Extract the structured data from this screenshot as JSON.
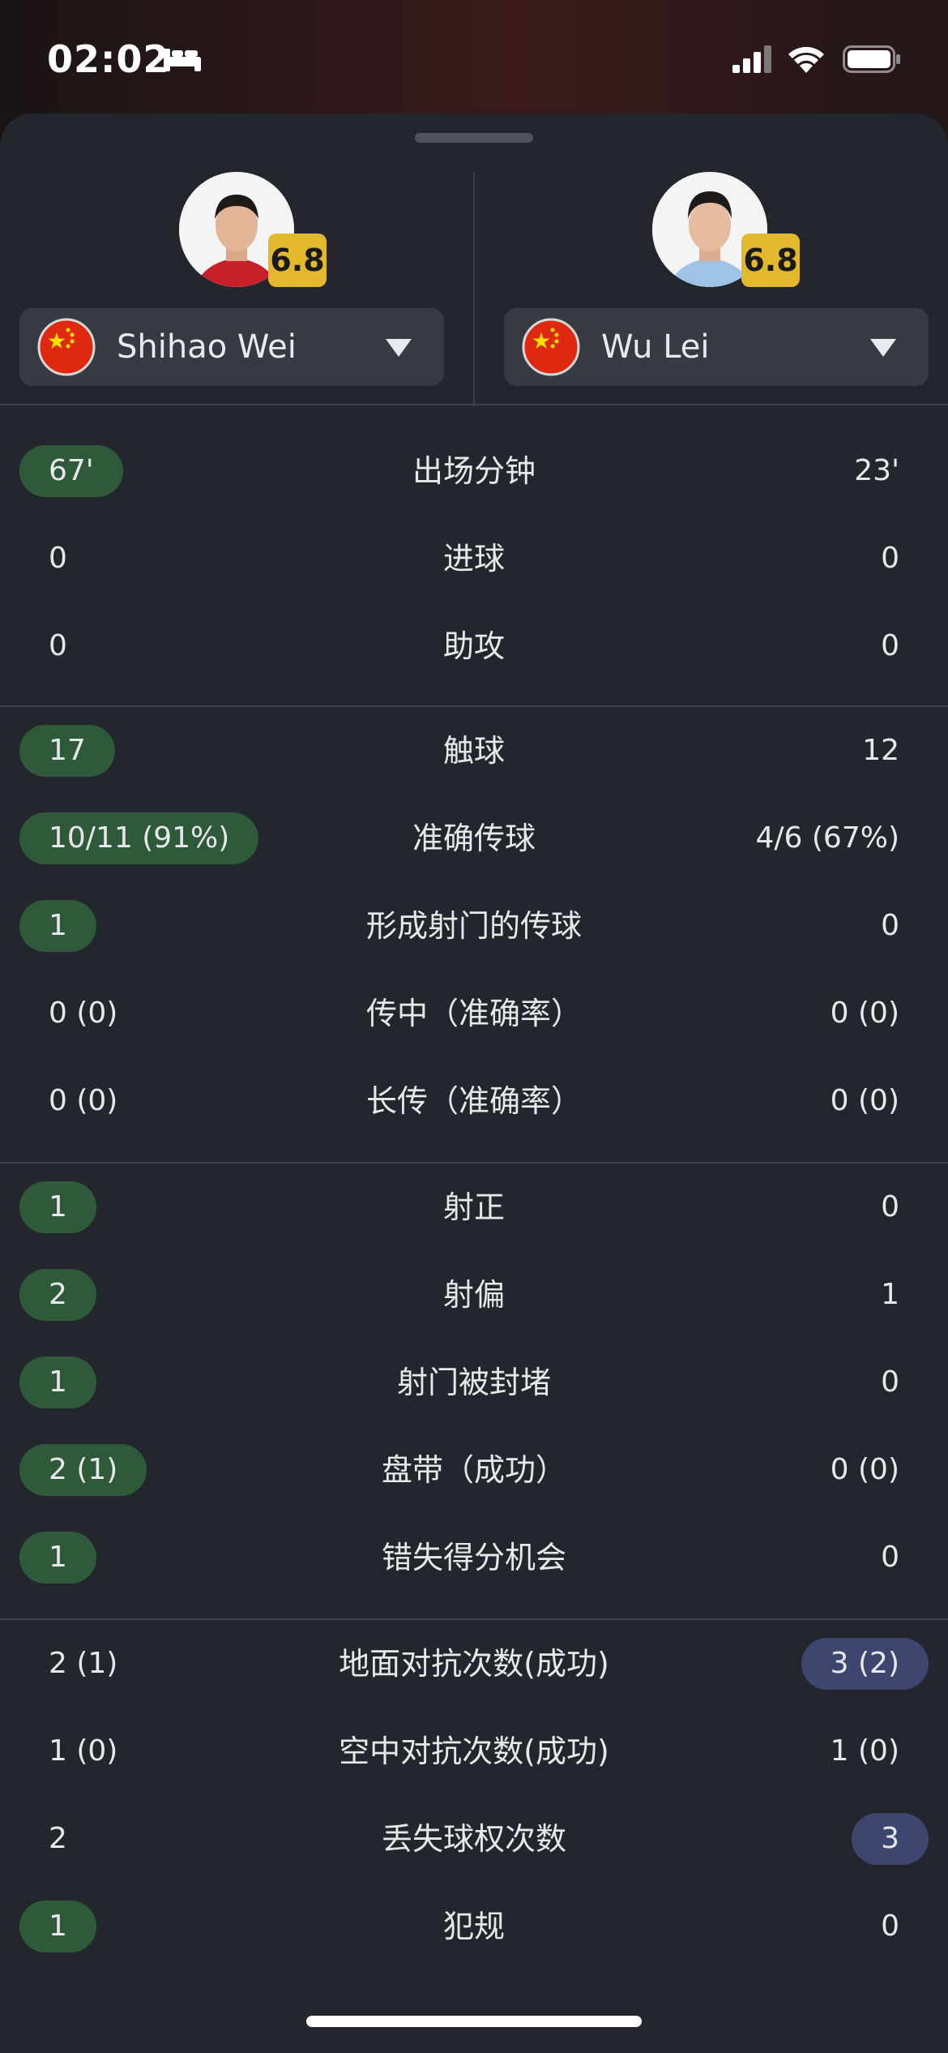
{
  "status_bar": {
    "time": "02:02",
    "icons": [
      "bed-icon",
      "signal-icon",
      "wifi-icon",
      "battery-icon"
    ]
  },
  "players": [
    {
      "name": "Shihao Wei",
      "rating": "6.8",
      "flag": "china-flag-icon"
    },
    {
      "name": "Wu Lei",
      "rating": "6.8",
      "flag": "china-flag-icon"
    }
  ],
  "colors": {
    "left_highlight": "#2f5a3a",
    "right_highlight": "#3e4670",
    "rating_badge": "#e4b82c"
  },
  "sections": [
    {
      "rows": [
        {
          "label": "出场分钟",
          "left": "67'",
          "right": "23'",
          "left_hl": true,
          "right_hl": false
        },
        {
          "label": "进球",
          "left": "0",
          "right": "0",
          "left_hl": false,
          "right_hl": false
        },
        {
          "label": "助攻",
          "left": "0",
          "right": "0",
          "left_hl": false,
          "right_hl": false
        }
      ]
    },
    {
      "rows": [
        {
          "label": "触球",
          "left": "17",
          "right": "12",
          "left_hl": true,
          "right_hl": false
        },
        {
          "label": "准确传球",
          "left": "10/11 (91%)",
          "right": "4/6 (67%)",
          "left_hl": true,
          "right_hl": false
        },
        {
          "label": "形成射门的传球",
          "left": "1",
          "right": "0",
          "left_hl": true,
          "right_hl": false
        },
        {
          "label": "传中（准确率）",
          "left": "0 (0)",
          "right": "0 (0)",
          "left_hl": false,
          "right_hl": false
        },
        {
          "label": "长传（准确率）",
          "left": "0 (0)",
          "right": "0 (0)",
          "left_hl": false,
          "right_hl": false
        }
      ]
    },
    {
      "rows": [
        {
          "label": "射正",
          "left": "1",
          "right": "0",
          "left_hl": true,
          "right_hl": false
        },
        {
          "label": "射偏",
          "left": "2",
          "right": "1",
          "left_hl": true,
          "right_hl": false
        },
        {
          "label": "射门被封堵",
          "left": "1",
          "right": "0",
          "left_hl": true,
          "right_hl": false
        },
        {
          "label": "盘带（成功）",
          "left": "2 (1)",
          "right": "0 (0)",
          "left_hl": true,
          "right_hl": false
        },
        {
          "label": "错失得分机会",
          "left": "1",
          "right": "0",
          "left_hl": true,
          "right_hl": false
        }
      ]
    },
    {
      "rows": [
        {
          "label": "地面对抗次数(成功)",
          "left": "2 (1)",
          "right": "3 (2)",
          "left_hl": false,
          "right_hl": true
        },
        {
          "label": "空中对抗次数(成功)",
          "left": "1 (0)",
          "right": "1 (0)",
          "left_hl": false,
          "right_hl": false
        },
        {
          "label": "丢失球权次数",
          "left": "2",
          "right": "3",
          "left_hl": false,
          "right_hl": true
        },
        {
          "label": "犯规",
          "left": "1",
          "right": "0",
          "left_hl": true,
          "right_hl": false
        }
      ]
    }
  ]
}
